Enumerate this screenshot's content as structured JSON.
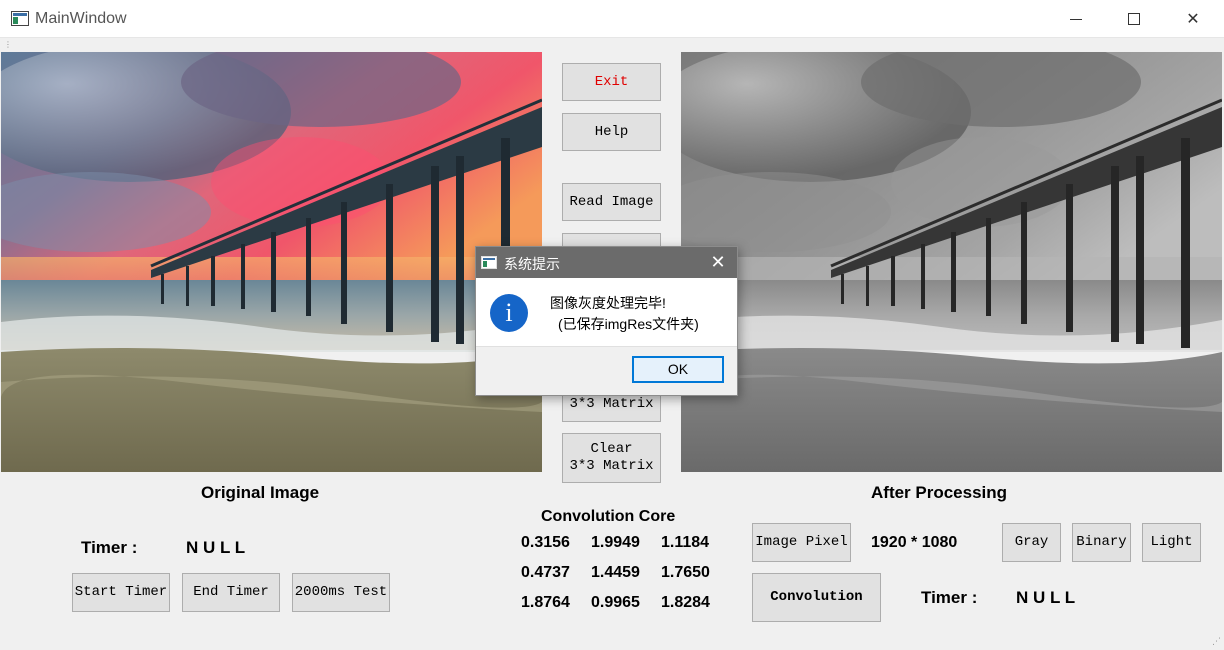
{
  "window": {
    "title": "MainWindow",
    "minimize": "",
    "maximize": "",
    "close": "✕"
  },
  "center_buttons": {
    "exit": "Exit",
    "help": "Help",
    "read_image": "Read Image",
    "matrix": "3*3 Matrix",
    "clear_matrix_line1": "Clear",
    "clear_matrix_line2": "3*3 Matrix"
  },
  "left_panel": {
    "heading": "Original Image",
    "timer_label": "Timer :",
    "timer_value": "N U L L",
    "start_timer": "Start Timer",
    "end_timer": "End Timer",
    "test_2000ms": "2000ms Test"
  },
  "convolution_core": {
    "heading": "Convolution Core",
    "rows": [
      [
        "0.3156",
        "1.9949",
        "1.1184"
      ],
      [
        "0.4737",
        "1.4459",
        "1.7650"
      ],
      [
        "1.8764",
        "0.9965",
        "1.8284"
      ]
    ]
  },
  "right_panel": {
    "heading": "After Processing",
    "image_pixel_button": "Image Pixel",
    "resolution": "1920 * 1080",
    "gray": "Gray",
    "binary": "Binary",
    "light": "Light",
    "convolution": "Convolution",
    "timer_label": "Timer :",
    "timer_value": "N U L L"
  },
  "dialog": {
    "title": "系统提示",
    "close": "✕",
    "icon": "i",
    "message_line1": "图像灰度处理完毕!",
    "message_line2": "(已保存imgRes文件夹)",
    "ok": "OK"
  },
  "icons": {
    "app": "app-window-icon",
    "info": "info-icon",
    "dialog_app": "dialog-window-icon"
  },
  "colors": {
    "exit_text": "#e00000",
    "dialog_title_bar": "#6b6b6b",
    "info_icon": "#1565c8",
    "ok_border": "#0078d7"
  }
}
